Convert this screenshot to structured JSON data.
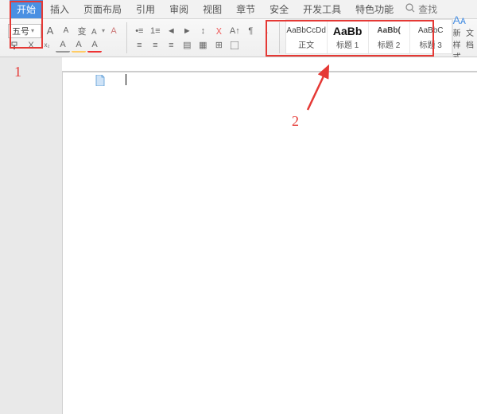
{
  "tabs": {
    "items": [
      "开始",
      "插入",
      "页面布局",
      "引用",
      "审阅",
      "视图",
      "章节",
      "安全",
      "开发工具",
      "特色功能"
    ],
    "active_index": 0,
    "search_label": "查找"
  },
  "ribbon": {
    "font_size": "五号",
    "buttons": {
      "increase_font": "A",
      "decrease_font": "A",
      "phonetic": "变",
      "clear": "A",
      "format_painter": " ",
      "bold": "X",
      "underline": "A",
      "highlight": "A",
      "color": "A"
    },
    "para_icons": [
      "≡",
      "≡",
      "≡",
      "▤",
      "↕",
      "¶",
      "▦",
      "A↑"
    ]
  },
  "styles": {
    "items": [
      {
        "preview": "AaBbCcDd",
        "label": "正文",
        "variant": "normal"
      },
      {
        "preview": "AaBb",
        "label": "标题 1",
        "variant": "h1"
      },
      {
        "preview": "AaBb(",
        "label": "标题 2",
        "variant": "normal"
      },
      {
        "preview": "AaBbC",
        "label": "标题 3",
        "variant": "normal"
      }
    ],
    "new_style_label": "新样式",
    "text_format_label": "文档"
  },
  "annotations": {
    "label1": "1",
    "label2": "2"
  }
}
